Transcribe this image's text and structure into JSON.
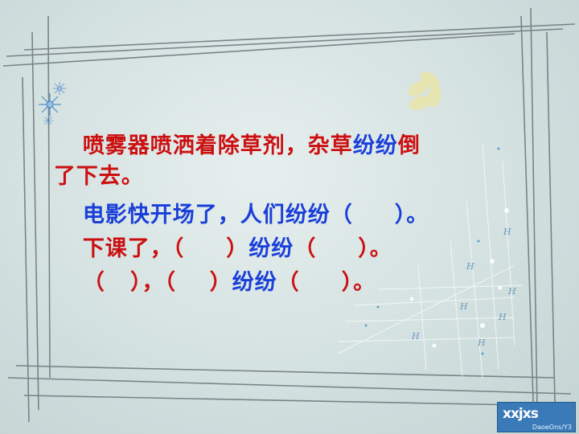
{
  "slide": {
    "line1": {
      "a": "喷雾器喷洒着除草剂，杂草",
      "b": "纷纷",
      "c": "倒"
    },
    "line2": "了下去。",
    "line3": {
      "a": "电影快开场了，人们",
      "b": "纷纷",
      "c": "（     ）。"
    },
    "line4": {
      "a": "下课了，（     ）",
      "b": "纷纷",
      "c": "（     ）。"
    },
    "line5": {
      "a": "（   ），（    ）",
      "b": "纷纷",
      "c": "（     ）。"
    }
  },
  "logo": {
    "text": "xxjxs",
    "sub": "DaoeOns/Y3"
  },
  "colors": {
    "red": "#cc1010",
    "blue": "#1a3fd9",
    "background": "#d3e1e0"
  }
}
